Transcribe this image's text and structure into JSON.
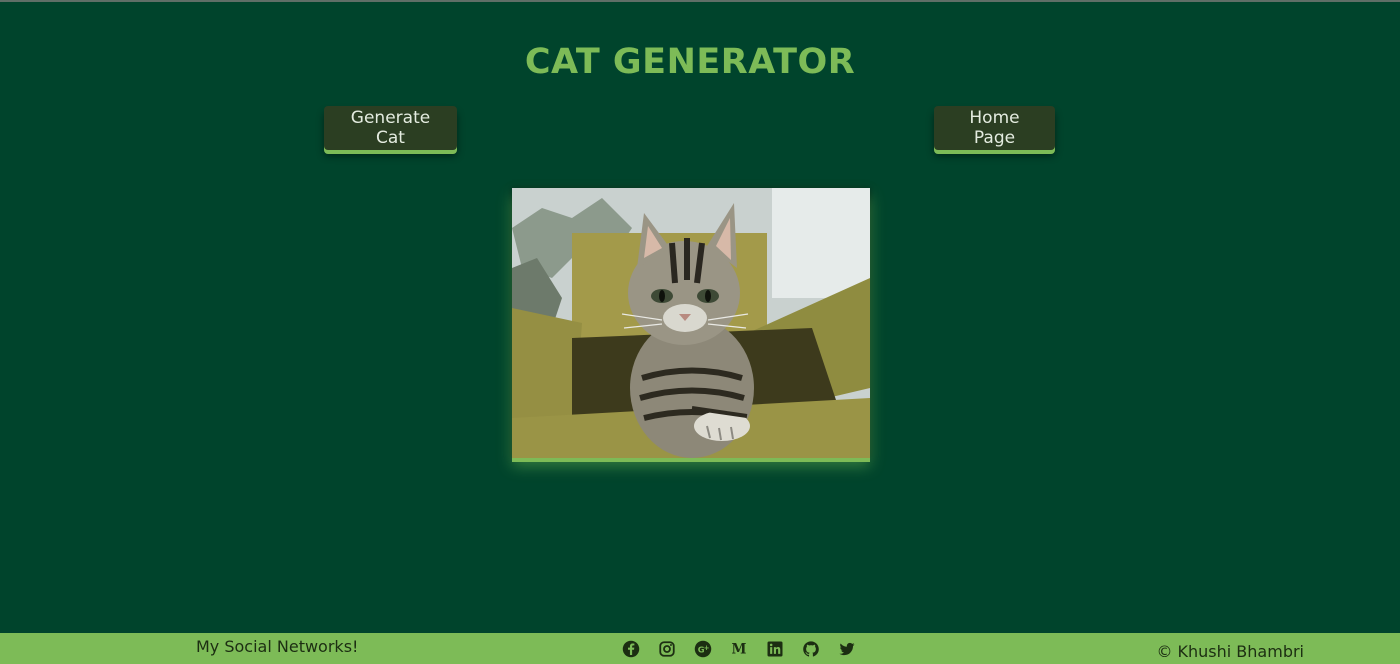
{
  "title": "CAT GENERATOR",
  "buttons": {
    "generate": "Generate Cat",
    "home": "Home Page"
  },
  "image": {
    "subject": "tabby kitten in cardboard box"
  },
  "footer": {
    "social_label": "My Social Networks!",
    "copyright": "© Khushi Bhambri",
    "icons": [
      "facebook-icon",
      "instagram-icon",
      "google-plus-icon",
      "medium-icon",
      "linkedin-icon",
      "github-icon",
      "twitter-icon"
    ]
  },
  "colors": {
    "background": "#00442c",
    "accent": "#7dbb57",
    "button": "#2b3e22"
  }
}
